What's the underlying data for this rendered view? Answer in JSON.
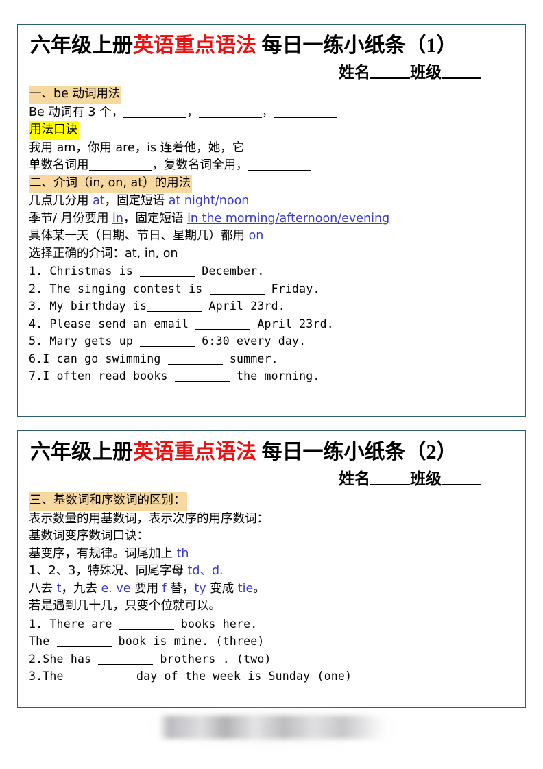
{
  "document": {
    "title_prefix": "六年级上册",
    "title_red": "英语重点语法",
    "title_suffix_1": " 每日一练小纸条（1）",
    "title_suffix_2": " 每日一练小纸条（2）",
    "name_label": "姓名",
    "class_label": "班级",
    "accent_red": "#ee1111",
    "accent_blue": "#3b3bc8",
    "highlight_tan": "#f7d9a0",
    "highlight_yellow": "#ffff00",
    "border_color": "#2e5d6e"
  },
  "card1": {
    "section1_heading": "一、be 动词用法",
    "be_intro_pre": "Be 动词有 3 个，",
    "be_intro_c1": "，",
    "be_intro_c2": "，",
    "mnemonic_heading": "用法口诀",
    "mnemonic_line": "我用 am，你用 are，is 连着他，她，它",
    "singular_pre": "单数名词用",
    "singular_mid": "，复数名词全用，",
    "section2_heading": "二、介词（in, on, at）的用法",
    "prep_at_pre": "几点几分用 ",
    "prep_at_word": "at",
    "prep_at_mid": "，固定短语 ",
    "prep_at_phrase": "at night/noon",
    "prep_in_pre": "季节/ 月份要用 ",
    "prep_in_word": "in",
    "prep_in_mid": "，固定短语 ",
    "prep_in_phrase": "in the morning/afternoon/evening",
    "prep_on_pre": "具体某一天（日期、节日、星期几）都用 ",
    "prep_on_word": "on",
    "exercise_instruction": "选择正确的介词：at, in, on",
    "exercises": [
      {
        "num": "1.",
        "pre": "Christmas is ",
        "post": " December."
      },
      {
        "num": "2.",
        "pre": "The singing contest is ",
        "post": " Friday."
      },
      {
        "num": "3.",
        "pre": "My birthday is",
        "post": " April 23rd."
      },
      {
        "num": "4.",
        "pre": "Please send an email ",
        "post": " April 23rd."
      },
      {
        "num": "5.",
        "pre": "Mary gets up ",
        "post": " 6:30 every day."
      },
      {
        "num": "6.",
        "pre": "I can go swimming ",
        "post": " summer."
      },
      {
        "num": "7.",
        "pre": "I often read books ",
        "post": " the morning."
      }
    ]
  },
  "card2": {
    "section3_heading": "三、基数词和序数词的区别：",
    "line_a": "表示数量的用基数词，表示次序的用序数词：",
    "line_b": "基数词变序数词口诀：",
    "line_c_pre": "基变序，有规律。词尾加上",
    "line_c_blue": " th",
    "line_d_pre": "1、2、3，特殊况、同尾字母 ",
    "line_d_blue": "td、d.",
    "line_e_pre": "八去 ",
    "line_e_b1": "t",
    "line_e_m1": "，九去",
    "line_e_b2": " e. ve ",
    "line_e_m2": "要用 ",
    "line_e_b3": "f",
    "line_e_m3": " 替，",
    "line_e_b4": "ty",
    "line_e_m4": " 变成 ",
    "line_e_b5": "tie",
    "line_e_m5": "。",
    "line_f": "若是遇到几十几，只变个位就可以。",
    "exercises": [
      {
        "num": "1.",
        "pre": "There are ",
        "post": " books here."
      },
      {
        "num": "",
        "pre": "The ",
        "post": " book is mine. (three)"
      },
      {
        "num": "2.",
        "pre": "She has ",
        "post": " brothers . (two)"
      },
      {
        "num": "3.",
        "pre": "The ",
        "post": " day of the week is Sunday (one)"
      }
    ]
  }
}
